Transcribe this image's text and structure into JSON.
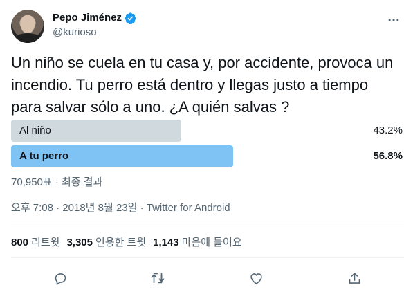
{
  "author": {
    "display_name": "Pepo Jiménez",
    "handle": "@kurioso",
    "verified": true
  },
  "tweet": {
    "text": "Un niño se cuela en tu casa y, por accidente, provoca un incendio. Tu perro está dentro y llegas justo a tiempo para salvar sólo a uno. ¿A quién salvas ?"
  },
  "poll": {
    "options": [
      {
        "label": "Al niño",
        "percent_text": "43.2%",
        "percent": 43.2,
        "winner": false
      },
      {
        "label": "A tu perro",
        "percent_text": "56.8%",
        "percent": 56.8,
        "winner": true
      }
    ],
    "meta": "70,950표 · 최종 결과"
  },
  "timestamp": "오후 7:08 · 2018년 8월 23일 · Twitter for Android",
  "stats": [
    {
      "num": "800",
      "label": "리트윗"
    },
    {
      "num": "3,305",
      "label": "인용한 트윗"
    },
    {
      "num": "1,143",
      "label": "마음에 들어요"
    }
  ],
  "colors": {
    "verified": "#1d9bf0",
    "winner_bar": "#7fc3f5",
    "loser_bar": "#cfd9de",
    "secondary_text": "#536471"
  },
  "icons": {
    "more": "more-horizontal-icon",
    "reply": "reply-icon",
    "retweet": "retweet-icon",
    "like": "heart-icon",
    "share": "share-icon"
  }
}
